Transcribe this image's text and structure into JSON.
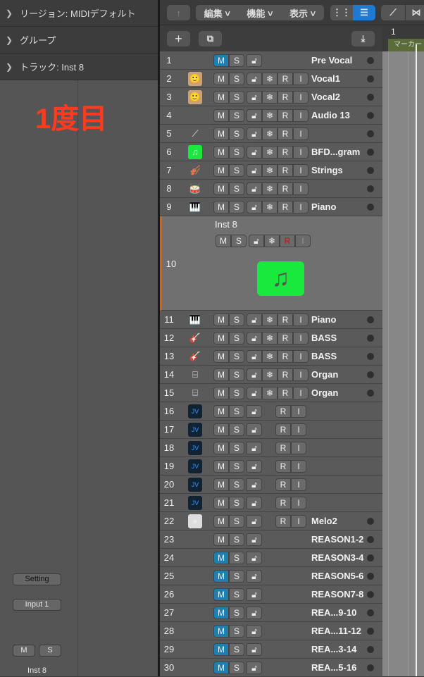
{
  "inspector": {
    "region": "リージョン: MIDIデフォルト",
    "group": "グループ",
    "track": "トラック: Inst 8",
    "annotation": "1度目",
    "setting": "Setting",
    "input": "Input 1",
    "mute": "M",
    "solo": "S",
    "channel_name": "Inst 8"
  },
  "toolbar": {
    "edit": "編集",
    "functions": "機能",
    "view": "表示",
    "ruler_bar": "1",
    "marker": "マーカー"
  },
  "tracks": [
    {
      "n": "1",
      "icon": "",
      "m": true,
      "set": "lock",
      "name": "Pre Vocal",
      "dot": true
    },
    {
      "n": "2",
      "icon": "vocal-photo",
      "m": false,
      "set": "full",
      "name": "Vocal1",
      "dot": true
    },
    {
      "n": "3",
      "icon": "vocal-photo",
      "m": false,
      "set": "full",
      "name": "Vocal2",
      "dot": true
    },
    {
      "n": "4",
      "icon": "",
      "m": false,
      "set": "full",
      "name": "Audio 13",
      "dot": true
    },
    {
      "n": "5",
      "icon": "guitar",
      "m": false,
      "set": "full",
      "name": "",
      "dot": true
    },
    {
      "n": "6",
      "icon": "music-note",
      "m": false,
      "set": "full",
      "name": "BFD...gram",
      "dot": true
    },
    {
      "n": "7",
      "icon": "strings",
      "m": false,
      "set": "full",
      "name": "Strings",
      "dot": true
    },
    {
      "n": "8",
      "icon": "drums",
      "m": false,
      "set": "full",
      "name": "",
      "dot": true
    },
    {
      "n": "9",
      "icon": "piano",
      "m": false,
      "set": "full",
      "name": "Piano",
      "dot": true
    },
    {
      "n": "10",
      "icon": "music-note",
      "m": false,
      "set": "full",
      "name": "Inst 8",
      "dot": false,
      "expanded": true
    },
    {
      "n": "11",
      "icon": "piano",
      "m": false,
      "set": "full",
      "name": "Piano",
      "dot": true
    },
    {
      "n": "12",
      "icon": "bass",
      "m": false,
      "set": "full",
      "name": "BASS",
      "dot": true
    },
    {
      "n": "13",
      "icon": "bass",
      "m": false,
      "set": "full",
      "name": "BASS",
      "dot": true
    },
    {
      "n": "14",
      "icon": "organ",
      "m": false,
      "set": "full",
      "name": "Organ",
      "dot": true
    },
    {
      "n": "15",
      "icon": "organ",
      "m": false,
      "set": "full",
      "name": "Organ",
      "dot": true
    },
    {
      "n": "16",
      "icon": "roland",
      "m": false,
      "set": "lockri",
      "name": "",
      "dot": false
    },
    {
      "n": "17",
      "icon": "roland",
      "m": false,
      "set": "lockri",
      "name": "",
      "dot": false
    },
    {
      "n": "18",
      "icon": "roland",
      "m": false,
      "set": "lockri",
      "name": "",
      "dot": false
    },
    {
      "n": "19",
      "icon": "roland",
      "m": false,
      "set": "lockri",
      "name": "",
      "dot": false
    },
    {
      "n": "20",
      "icon": "roland",
      "m": false,
      "set": "lockri",
      "name": "",
      "dot": false
    },
    {
      "n": "21",
      "icon": "roland",
      "m": false,
      "set": "lockri",
      "name": "",
      "dot": false
    },
    {
      "n": "22",
      "icon": "metronome",
      "m": false,
      "set": "lockri",
      "name": "Melo2",
      "dot": true
    },
    {
      "n": "23",
      "icon": "",
      "m": false,
      "set": "lock",
      "name": "REASON1-2",
      "dot": true
    },
    {
      "n": "24",
      "icon": "",
      "m": true,
      "set": "lock",
      "name": "REASON3-4",
      "dot": true
    },
    {
      "n": "25",
      "icon": "",
      "m": true,
      "set": "lock",
      "name": "REASON5-6",
      "dot": true
    },
    {
      "n": "26",
      "icon": "",
      "m": true,
      "set": "lock",
      "name": "REASON7-8",
      "dot": true
    },
    {
      "n": "27",
      "icon": "",
      "m": true,
      "set": "lock",
      "name": "REA...9-10",
      "dot": true
    },
    {
      "n": "28",
      "icon": "",
      "m": true,
      "set": "lock",
      "name": "REA...11-12",
      "dot": true
    },
    {
      "n": "29",
      "icon": "",
      "m": true,
      "set": "lock",
      "name": "REA...3-14",
      "dot": true
    },
    {
      "n": "30",
      "icon": "",
      "m": true,
      "set": "lock",
      "name": "REA...5-16",
      "dot": true
    }
  ],
  "colors": {
    "accent": "#1f7fae",
    "record": "#cc1111",
    "green_icon": "#19e83c"
  }
}
